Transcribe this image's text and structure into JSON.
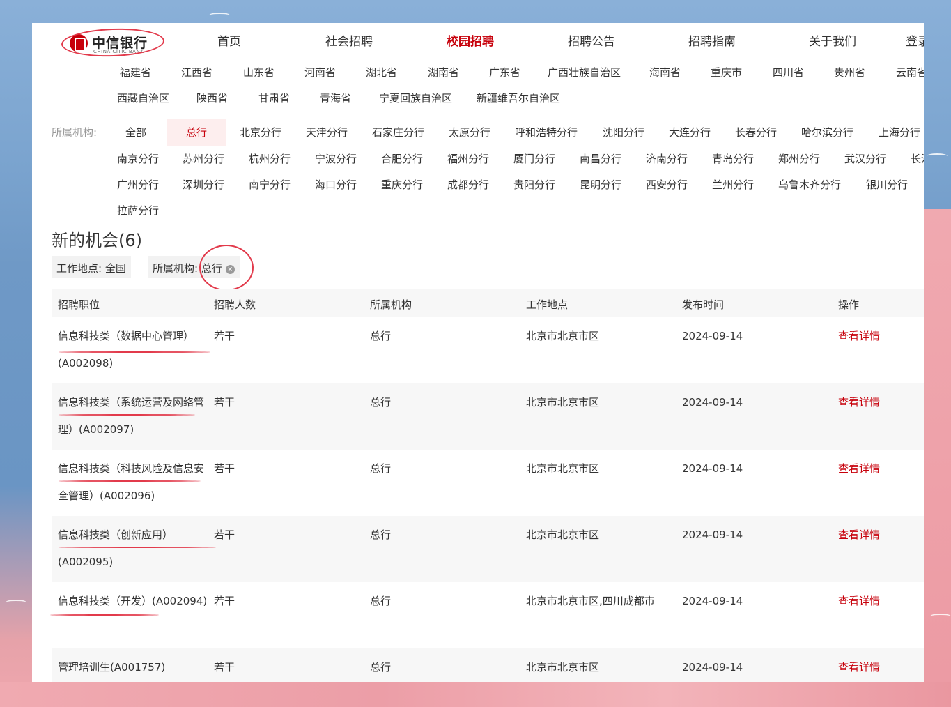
{
  "logo": {
    "cn": "中信银行",
    "en": "CHINA CITIC BANK"
  },
  "nav": [
    "首页",
    "社会招聘",
    "校园招聘",
    "招聘公告",
    "招聘指南",
    "关于我们",
    "登录"
  ],
  "provinces_row1": [
    "福建省",
    "江西省",
    "山东省",
    "河南省",
    "湖北省",
    "湖南省",
    "广东省",
    "广西壮族自治区",
    "海南省",
    "重庆市",
    "四川省",
    "贵州省",
    "云南省"
  ],
  "provinces_row2": [
    "西藏自治区",
    "陕西省",
    "甘肃省",
    "青海省",
    "宁夏回族自治区",
    "新疆维吾尔自治区"
  ],
  "org_filter": {
    "label": "所属机构:",
    "row1": [
      "全部",
      "总行",
      "北京分行",
      "天津分行",
      "石家庄分行",
      "太原分行",
      "呼和浩特分行",
      "沈阳分行",
      "大连分行",
      "长春分行",
      "哈尔滨分行",
      "上海分行"
    ],
    "row2": [
      "南京分行",
      "苏州分行",
      "杭州分行",
      "宁波分行",
      "合肥分行",
      "福州分行",
      "厦门分行",
      "南昌分行",
      "济南分行",
      "青岛分行",
      "郑州分行",
      "武汉分行",
      "长沙分行"
    ],
    "row3": [
      "广州分行",
      "深圳分行",
      "南宁分行",
      "海口分行",
      "重庆分行",
      "成都分行",
      "贵阳分行",
      "昆明分行",
      "西安分行",
      "兰州分行",
      "乌鲁木齐分行",
      "银川分行"
    ],
    "row4": [
      "拉萨分行"
    ]
  },
  "results": {
    "title": "新的机会(6)",
    "tag_location": "工作地点:  全国",
    "tag_org": "所属机构: 总行",
    "tag_close": "×"
  },
  "table": {
    "headers": [
      "招聘职位",
      "招聘人数",
      "所属机构",
      "工作地点",
      "发布时间",
      "操作"
    ],
    "rows": [
      {
        "title": "信息科技类（数据中心管理）(A002098)",
        "count": "若干",
        "org": "总行",
        "location": "北京市北京市区",
        "date": "2024-09-14",
        "action": "查看详情"
      },
      {
        "title": "信息科技类（系统运营及网络管理）(A002097)",
        "count": "若干",
        "org": "总行",
        "location": "北京市北京市区",
        "date": "2024-09-14",
        "action": "查看详情"
      },
      {
        "title": "信息科技类（科技风险及信息安全管理）(A002096)",
        "count": "若干",
        "org": "总行",
        "location": "北京市北京市区",
        "date": "2024-09-14",
        "action": "查看详情"
      },
      {
        "title": "信息科技类（创新应用）(A002095)",
        "count": "若干",
        "org": "总行",
        "location": "北京市北京市区",
        "date": "2024-09-14",
        "action": "查看详情"
      },
      {
        "title": "信息科技类（开发）(A002094)",
        "count": "若干",
        "org": "总行",
        "location": "北京市北京市区,四川成都市",
        "date": "2024-09-14",
        "action": "查看详情"
      },
      {
        "title": "管理培训生(A001757)",
        "count": "若干",
        "org": "总行",
        "location": "北京市北京市区",
        "date": "2024-09-14",
        "action": "查看详情"
      }
    ]
  },
  "colors": {
    "brand_red": "#c7000b",
    "annotation_red": "#e23a4b",
    "selected_bg": "#fdeeee"
  }
}
